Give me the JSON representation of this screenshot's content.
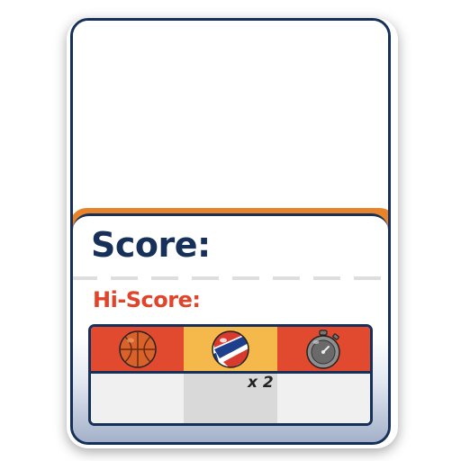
{
  "scoreboard": {
    "score_label": "Score:",
    "hiscore_label": "Hi-Score:"
  },
  "powerups": [
    {
      "icon": "basketball-icon",
      "count": "",
      "active": false
    },
    {
      "icon": "striped-ball-icon",
      "count": "x 2",
      "active": true
    },
    {
      "icon": "stopwatch-icon",
      "count": "",
      "active": false
    }
  ],
  "colors": {
    "navy": "#16305a",
    "orange": "#e9832a",
    "red": "#e24a30",
    "gold": "#f4b94a",
    "hiscore_red": "#e2442b"
  }
}
